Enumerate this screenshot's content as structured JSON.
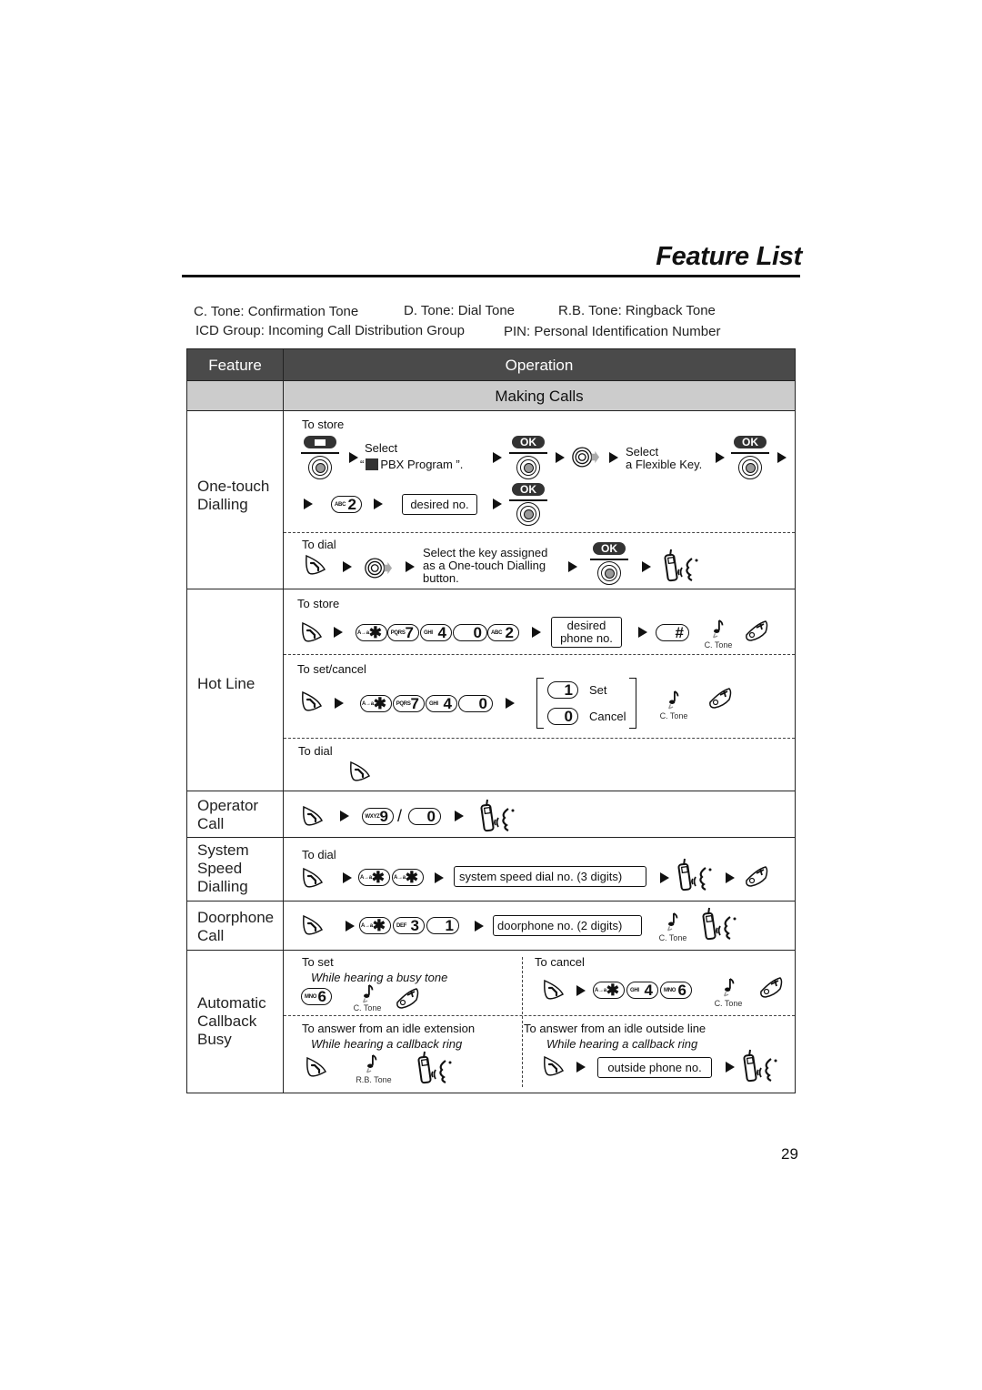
{
  "page": {
    "title": "Feature List",
    "page_number": "29"
  },
  "legend": {
    "c_tone": "C. Tone: Confirmation Tone",
    "d_tone": "D. Tone: Dial Tone",
    "rb_tone": "R.B. Tone: Ringback Tone",
    "icd_group": "ICD Group: Incoming Call Distribution Group",
    "pin": "PIN: Personal Identification Number"
  },
  "table": {
    "header_feature": "Feature",
    "header_operation": "Operation",
    "section": "Making Calls"
  },
  "icons": {
    "off_hook": "off-hook-icon",
    "on_hook": "on-hook-icon",
    "talk": "talk-icon",
    "tone": "tone-icon",
    "nav_key": "navigator-key-icon",
    "jog": "jog-dial-icon",
    "arrow": "arrow-right-icon"
  },
  "common": {
    "ok": "OK",
    "c_tone": "C. Tone",
    "rb_tone": "R.B. Tone",
    "to_store": "To store",
    "to_dial": "To dial",
    "to_set_cancel": "To set/cancel",
    "to_set": "To set",
    "to_cancel": "To cancel"
  },
  "keys": {
    "star": {
      "small": "A→a",
      "big": "✱"
    },
    "k0": {
      "small": "",
      "big": "0"
    },
    "k1": {
      "small": "",
      "big": "1"
    },
    "k2": {
      "small": "ABC",
      "big": "2"
    },
    "k3": {
      "small": "DEF",
      "big": "3"
    },
    "k4": {
      "small": "GHI",
      "big": "4"
    },
    "k6": {
      "small": "MNO",
      "big": "6"
    },
    "k7": {
      "small": "PQRS",
      "big": "7"
    },
    "k9": {
      "small": "WXYZ",
      "big": "9"
    },
    "hash": {
      "small": "",
      "big": "#"
    }
  },
  "features": [
    {
      "name_line1": "One-touch",
      "name_line2": "Dialling",
      "store_select_pbx_1": "Select",
      "store_select_pbx_2a": "“",
      "store_select_pbx_2b": "PBX Program ”.",
      "store_select_flex_1": "Select",
      "store_select_flex_2": "a Flexible Key.",
      "desired_no": "desired no.",
      "dial_select_1": "Select the key assigned",
      "dial_select_2": "as a One-touch Dialling",
      "dial_select_3": "button."
    },
    {
      "name_line1": "Hot Line",
      "desired_phone_1": "desired",
      "desired_phone_2": "phone no.",
      "set": "Set",
      "cancel": "Cancel"
    },
    {
      "name_line1": "Operator",
      "name_line2": "Call",
      "slash": "/"
    },
    {
      "name_line1": "System",
      "name_line2": "Speed",
      "name_line3": "Dialling",
      "speed_dial_box": "system speed dial no. (3 digits)"
    },
    {
      "name_line1": "Doorphone",
      "name_line2": "Call",
      "doorphone_box": "doorphone no. (2 digits)"
    },
    {
      "name_line1": "Automatic",
      "name_line2": "Callback",
      "name_line3": "Busy",
      "while_busy": "While hearing a busy tone",
      "answer_ext": "To answer from an idle extension",
      "answer_line": "To answer from an idle outside line",
      "while_callback": "While hearing a callback ring",
      "outside_box": "outside phone no."
    }
  ]
}
